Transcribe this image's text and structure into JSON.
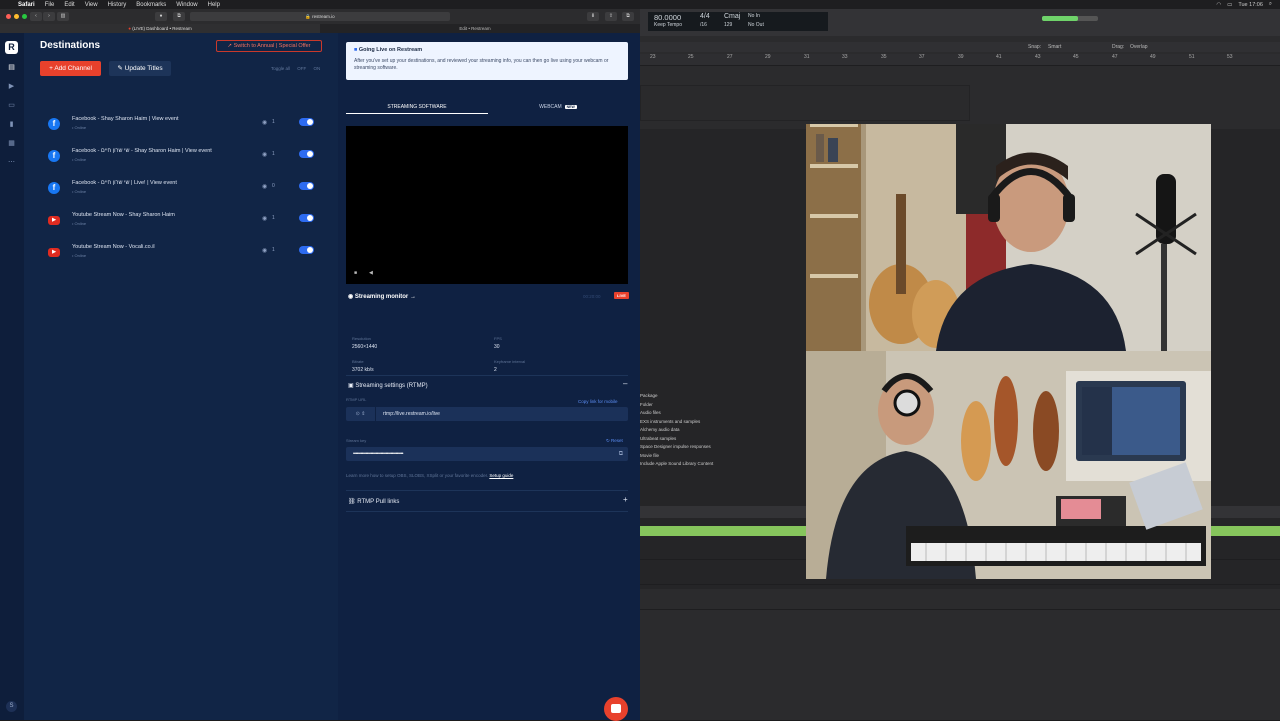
{
  "menubar": {
    "app": "Safari",
    "items": [
      "File",
      "Edit",
      "View",
      "History",
      "Bookmarks",
      "Window",
      "Help"
    ],
    "clock": "Tue 17:06"
  },
  "safari": {
    "address": "restream.io",
    "tab_active": "(LIVE) Dashboard • Restream",
    "tab_other": "Edit • Restream"
  },
  "rail": {
    "logo": "R",
    "user": "S"
  },
  "destinations": {
    "title": "Destinations",
    "offer": "Switch to Annual | Special Offer",
    "add_channel": "+ Add Channel",
    "update_titles": "Update Titles",
    "toggle_all": "Toggle all",
    "off": "OFF",
    "on": "ON",
    "items": [
      {
        "platform": "facebook",
        "name": "Facebook - Shay Sharon Haim | View event",
        "status": "• Online",
        "viewers": "1"
      },
      {
        "platform": "facebook",
        "name": "Facebook - שי שרון חיים - Shay Sharon Haim | View event",
        "status": "• Online",
        "viewers": "1"
      },
      {
        "platform": "facebook",
        "name": "Facebook - שי שרון חיים | Live! | View event",
        "status": "• Online",
        "viewers": "0"
      },
      {
        "platform": "youtube",
        "name": "Youtube Stream Now - Shay Sharon Haim",
        "status": "• Online",
        "viewers": "1"
      },
      {
        "platform": "youtube",
        "name": "Youtube Stream Now - Vocali.co.il",
        "status": "• Online",
        "viewers": "1"
      }
    ]
  },
  "main": {
    "golive_title": "Going Live on Restream",
    "golive_desc": "After you've set up your destinations, and reviewed your streaming info, you can then go live using your webcam or streaming software.",
    "tab_software": "STREAMING SOFTWARE",
    "tab_webcam": "WEBCAM",
    "new_badge": "NEW",
    "monitor_title": "Streaming monitor",
    "monitor_time": "00:20:00",
    "live_badge": "LIVE",
    "stats": {
      "resolution_label": "Resolution",
      "resolution": "2560×1440",
      "fps_label": "FPS",
      "fps": "30",
      "bitrate_label": "Bitrate",
      "bitrate": "3702 kb/s",
      "keyframe_label": "Keyframe interval",
      "keyframe": "2"
    },
    "rtmp_title": "Streaming settings (RTMP)",
    "rtmp_url_label": "RTMP URL",
    "copy_mobile": "Copy link for mobile",
    "rtmp_url": "rtmp://live.restream.io/live",
    "stream_key_label": "Stream key",
    "reset": "Reset",
    "stream_key": "••••••••••••••••••••••••••••••••••••••••",
    "learn_text": "Learn more how to setup OBS, SLOBS, XSplit or your favorite encoder.",
    "setup_guide": "Setup guide",
    "pull_title": "RTMP Pull links"
  },
  "logic": {
    "tempo": "80.0000",
    "tempo_label": "Keep Tempo",
    "sig_top": "4/4",
    "sig_bottom": "/16",
    "key": "Cmaj",
    "key_num": "129",
    "in_label": "No In",
    "out_label": "No Out",
    "snap": "Snap:",
    "snap_val": "Smart",
    "drag": "Drag:",
    "drag_val": "Overlap",
    "ruler": [
      "23",
      "25",
      "27",
      "29",
      "31",
      "33",
      "35",
      "37",
      "39",
      "41",
      "43",
      "45",
      "47",
      "49",
      "51",
      "53"
    ],
    "library": [
      "Package",
      "Folder",
      "Audio files",
      "EXS instruments and samples",
      "Alchemy audio data",
      "Ultrabeat samples",
      "Space Designer impulse responses",
      "Movie file",
      "Include Apple Sound Library Content"
    ]
  }
}
